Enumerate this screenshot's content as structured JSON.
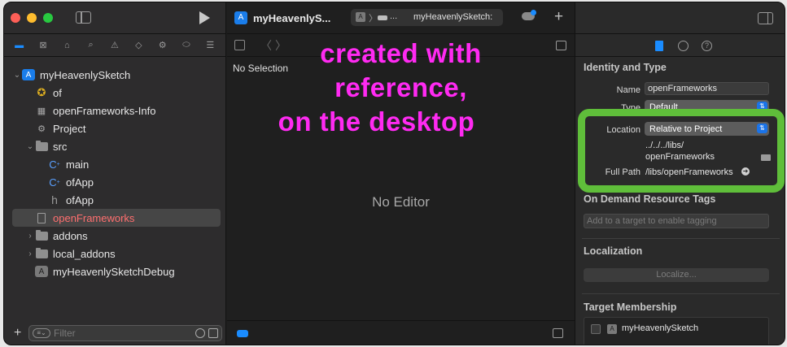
{
  "toolbar": {
    "project_title": "myHeavenlySketch",
    "project_title_display": "myHeavenlyS...",
    "breadcrumb_ellipsis": "...",
    "scheme_target": "myHeavenlySketch:",
    "add_label": "+"
  },
  "navigator": {
    "tree": [
      {
        "label": "myHeavenlySketch",
        "icon": "app-project-icon",
        "indent": 0,
        "disclosure": "open"
      },
      {
        "label": "of",
        "icon": "gear-badge-icon",
        "indent": 1
      },
      {
        "label": "openFrameworks-Info",
        "icon": "plist-table-icon",
        "indent": 1
      },
      {
        "label": "Project",
        "icon": "gears-icon",
        "indent": 1
      },
      {
        "label": "src",
        "icon": "folder-icon",
        "indent": 1,
        "disclosure": "open"
      },
      {
        "label": "main",
        "icon": "cpp-file-icon",
        "indent": 2
      },
      {
        "label": "ofApp",
        "icon": "cpp-file-icon",
        "indent": 2
      },
      {
        "label": "ofApp",
        "icon": "header-file-icon",
        "indent": 2
      },
      {
        "label": "openFrameworks",
        "icon": "document-icon",
        "indent": 1,
        "selected": true,
        "color": "#ff6f6f"
      },
      {
        "label": "addons",
        "icon": "folder-icon",
        "indent": 1,
        "disclosure": "closed"
      },
      {
        "label": "local_addons",
        "icon": "folder-icon",
        "indent": 1,
        "disclosure": "closed"
      },
      {
        "label": "myHeavenlySketchDebug",
        "icon": "app-product-icon",
        "indent": 1
      }
    ],
    "filter_placeholder": "Filter",
    "add_button": "+"
  },
  "editor": {
    "no_selection": "No Selection",
    "no_editor": "No Editor"
  },
  "annotation": {
    "lines": [
      "created with",
      "reference,",
      "on the desktop"
    ],
    "color": "#ff2af2"
  },
  "inspector": {
    "identity_header": "Identity and Type",
    "name_label": "Name",
    "name_value": "openFrameworks",
    "type_label": "Type",
    "type_value": "Default",
    "location_label": "Location",
    "location_value": "Relative to Project",
    "path_line1": "../../../libs/",
    "path_line2": "openFrameworks",
    "full_path_label": "Full Path",
    "full_path_value": "/libs/openFrameworks",
    "odr_header": "On Demand Resource Tags",
    "odr_placeholder": "Add to a target to enable tagging",
    "localization_header": "Localization",
    "localize_button": "Localize...",
    "membership_header": "Target Membership",
    "membership_target": "myHeavenlySketch",
    "highlight_color": "#5fbe3a"
  }
}
